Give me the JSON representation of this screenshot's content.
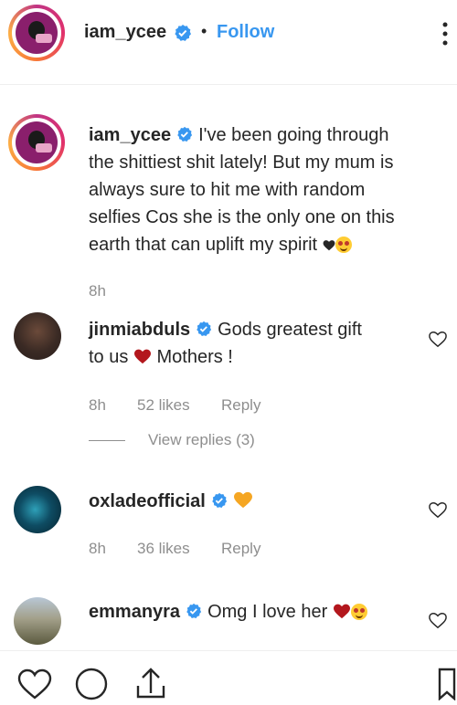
{
  "header": {
    "username": "iam_ycee",
    "separator": "•",
    "follow_label": "Follow",
    "more_icon": "ellipsis-icon"
  },
  "caption": {
    "username": "iam_ycee",
    "lines": [
      "I've been going through",
      "the shittiest shit lately! But my mum is",
      "always sure to hit me with random",
      "selfies Cos she is the only one on this",
      "earth that can uplift my spirit"
    ],
    "time": "8h"
  },
  "comments": [
    {
      "username": "jinmiabduls",
      "text_line1": "Gods greatest gift",
      "text_line2_a": "to us",
      "text_line2_b": "Mothers !",
      "time": "8h",
      "likes": "52 likes",
      "reply": "Reply",
      "view_replies": "View replies (3)"
    },
    {
      "username": "oxladeofficial",
      "time": "8h",
      "likes": "36 likes",
      "reply": "Reply"
    },
    {
      "username": "emmanyra",
      "text": "Omg I love her"
    }
  ],
  "colors": {
    "link_blue": "#3897f0",
    "verified_blue": "#3897f0",
    "heart_red": "#b3171d",
    "orange_heart": "#f5a623",
    "meta_gray": "#8e8e8e"
  }
}
